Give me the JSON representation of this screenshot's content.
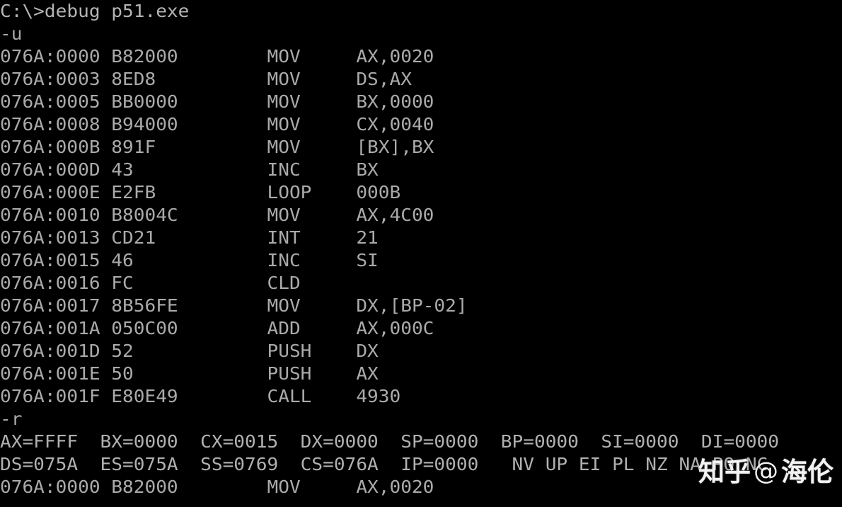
{
  "terminal": {
    "background_color": "#000000",
    "text_color": "#aaaaaa",
    "prompt": "C:\\>debug p51.exe",
    "command_unassemble": "-u",
    "command_register": "-r",
    "lines": [
      "C:\\>debug p51.exe",
      "-u",
      "076A:0000 B82000        MOV     AX,0020",
      "076A:0003 8ED8          MOV     DS,AX",
      "076A:0005 BB0000        MOV     BX,0000",
      "076A:0008 B94000        MOV     CX,0040",
      "076A:000B 891F          MOV     [BX],BX",
      "076A:000D 43            INC     BX",
      "076A:000E E2FB          LOOP    000B",
      "076A:0010 B8004C        MOV     AX,4C00",
      "076A:0013 CD21          INT     21",
      "076A:0015 46            INC     SI",
      "076A:0016 FC            CLD",
      "076A:0017 8B56FE        MOV     DX,[BP-02]",
      "076A:001A 050C00        ADD     AX,000C",
      "076A:001D 52            PUSH    DX",
      "076A:001E 50            PUSH    AX",
      "076A:001F E80E49        CALL    4930",
      "-r",
      "AX=FFFF  BX=0000  CX=0015  DX=0000  SP=0000  BP=0000  SI=0000  DI=0000",
      "DS=075A  ES=075A  SS=0769  CS=076A  IP=0000   NV UP EI PL NZ NA PO NC",
      "076A:0000 B82000        MOV     AX,0020"
    ],
    "disassembly": [
      {
        "address": "076A:0000",
        "bytes": "B82000",
        "mnemonic": "MOV",
        "operands": "AX,0020"
      },
      {
        "address": "076A:0003",
        "bytes": "8ED8",
        "mnemonic": "MOV",
        "operands": "DS,AX"
      },
      {
        "address": "076A:0005",
        "bytes": "BB0000",
        "mnemonic": "MOV",
        "operands": "BX,0000"
      },
      {
        "address": "076A:0008",
        "bytes": "B94000",
        "mnemonic": "MOV",
        "operands": "CX,0040"
      },
      {
        "address": "076A:000B",
        "bytes": "891F",
        "mnemonic": "MOV",
        "operands": "[BX],BX"
      },
      {
        "address": "076A:000D",
        "bytes": "43",
        "mnemonic": "INC",
        "operands": "BX"
      },
      {
        "address": "076A:000E",
        "bytes": "E2FB",
        "mnemonic": "LOOP",
        "operands": "000B"
      },
      {
        "address": "076A:0010",
        "bytes": "B8004C",
        "mnemonic": "MOV",
        "operands": "AX,4C00"
      },
      {
        "address": "076A:0013",
        "bytes": "CD21",
        "mnemonic": "INT",
        "operands": "21"
      },
      {
        "address": "076A:0015",
        "bytes": "46",
        "mnemonic": "INC",
        "operands": "SI"
      },
      {
        "address": "076A:0016",
        "bytes": "FC",
        "mnemonic": "CLD",
        "operands": ""
      },
      {
        "address": "076A:0017",
        "bytes": "8B56FE",
        "mnemonic": "MOV",
        "operands": "DX,[BP-02]"
      },
      {
        "address": "076A:001A",
        "bytes": "050C00",
        "mnemonic": "ADD",
        "operands": "AX,000C"
      },
      {
        "address": "076A:001D",
        "bytes": "52",
        "mnemonic": "PUSH",
        "operands": "DX"
      },
      {
        "address": "076A:001E",
        "bytes": "50",
        "mnemonic": "PUSH",
        "operands": "AX"
      },
      {
        "address": "076A:001F",
        "bytes": "E80E49",
        "mnemonic": "CALL",
        "operands": "4930"
      }
    ],
    "registers": {
      "general": [
        {
          "name": "AX",
          "value": "FFFF"
        },
        {
          "name": "BX",
          "value": "0000"
        },
        {
          "name": "CX",
          "value": "0015"
        },
        {
          "name": "DX",
          "value": "0000"
        },
        {
          "name": "SP",
          "value": "0000"
        },
        {
          "name": "BP",
          "value": "0000"
        },
        {
          "name": "SI",
          "value": "0000"
        },
        {
          "name": "DI",
          "value": "0000"
        }
      ],
      "segment": [
        {
          "name": "DS",
          "value": "075A"
        },
        {
          "name": "ES",
          "value": "075A"
        },
        {
          "name": "SS",
          "value": "0769"
        },
        {
          "name": "CS",
          "value": "076A"
        },
        {
          "name": "IP",
          "value": "0000"
        }
      ],
      "flags": "NV UP EI PL NZ"
    },
    "current_instruction": {
      "address": "076A:0000",
      "bytes": "B82000",
      "mnemonic": "MOV",
      "operands": "AX,0020"
    }
  },
  "watermark": {
    "site": "知乎",
    "at": "@",
    "user": "海伦",
    "color": "#f2f2f2"
  }
}
